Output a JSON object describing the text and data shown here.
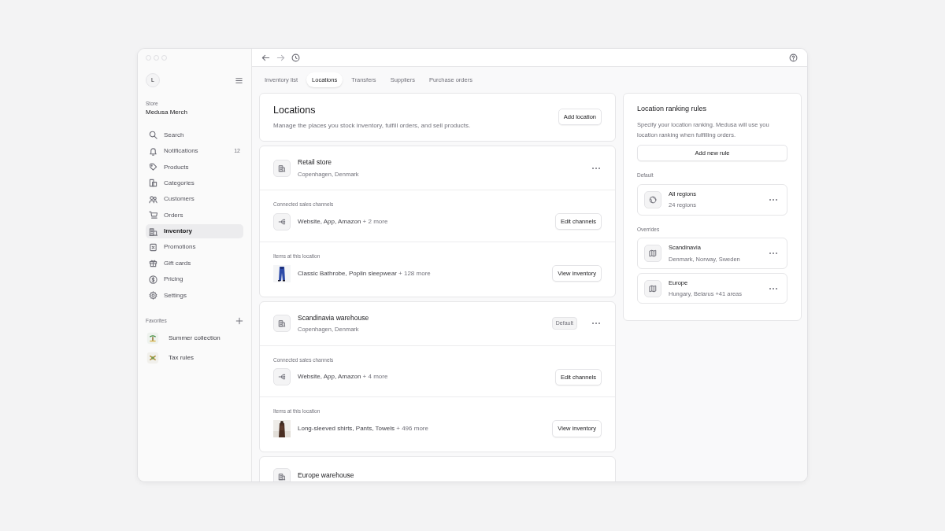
{
  "sidebar": {
    "avatar": "L",
    "store_label": "Store",
    "store_name": "Medusa Merch",
    "items": [
      {
        "label": "Search",
        "selected": false
      },
      {
        "label": "Notifications",
        "count": "12",
        "selected": false
      },
      {
        "label": "Products",
        "selected": false
      },
      {
        "label": "Categories",
        "selected": false
      },
      {
        "label": "Customers",
        "selected": false
      },
      {
        "label": "Orders",
        "selected": false
      },
      {
        "label": "Inventory",
        "selected": true
      },
      {
        "label": "Promotions",
        "selected": false
      },
      {
        "label": "Gift cards",
        "selected": false
      },
      {
        "label": "Pricing",
        "selected": false
      },
      {
        "label": "Settings",
        "selected": false
      }
    ],
    "favorites": {
      "title": "Favorites",
      "items": [
        {
          "label": "Summer collection"
        },
        {
          "label": "Tax rules"
        }
      ]
    }
  },
  "tabs": [
    {
      "label": "Inventory list",
      "selected": false
    },
    {
      "label": "Locations",
      "selected": true
    },
    {
      "label": "Transfers",
      "selected": false
    },
    {
      "label": "Suppliers",
      "selected": false
    },
    {
      "label": "Purchase orders",
      "selected": false
    }
  ],
  "header": {
    "title": "Locations",
    "description": "Manage the places you stock inventory, fulfill orders, and sell products.",
    "button": "Add location"
  },
  "locations": [
    {
      "name": "Retail store",
      "address": "Copenhagen, Denmark",
      "sections": [
        {
          "kind": "channels",
          "label": "Connected sales channels",
          "text": "Website, App, Amazon",
          "more": "+ 2 more",
          "button": "Edit channels"
        },
        {
          "kind": "items",
          "label": "Items at this location",
          "text": "Classic Bathrobe, Poplin sleepwear",
          "more": "+ 128 more",
          "button": "View inventory"
        }
      ]
    },
    {
      "name": "Scandinavia warehouse",
      "address": "Copenhagen, Denmark",
      "badge": "Default",
      "sections": [
        {
          "kind": "channels",
          "label": "Connected sales channels",
          "text": "Website, App, Amazon",
          "more": "+ 4 more",
          "button": "Edit channels"
        },
        {
          "kind": "items",
          "label": "Items at this location",
          "text": "Long-sleeved shirts, Pants, Towels",
          "more": "+ 496 more",
          "button": "View inventory"
        }
      ]
    },
    {
      "name": "Europe warehouse"
    }
  ],
  "ranking": {
    "title": "Location ranking rules",
    "description": "Specify your location ranking. Medusa will use you location ranking when fulfilling orders.",
    "button": "Add new rule",
    "groups": [
      {
        "label": "Default",
        "kind": "globe",
        "rules": [
          {
            "name": "All regions",
            "detail": "24 regions"
          }
        ]
      },
      {
        "label": "Overrides",
        "kind": "map",
        "rules": [
          {
            "name": "Scandinavia",
            "detail": "Denmark, Norway, Sweden"
          },
          {
            "name": "Europe",
            "detail": "Hungary, Belarus +41 areas"
          }
        ]
      }
    ]
  }
}
